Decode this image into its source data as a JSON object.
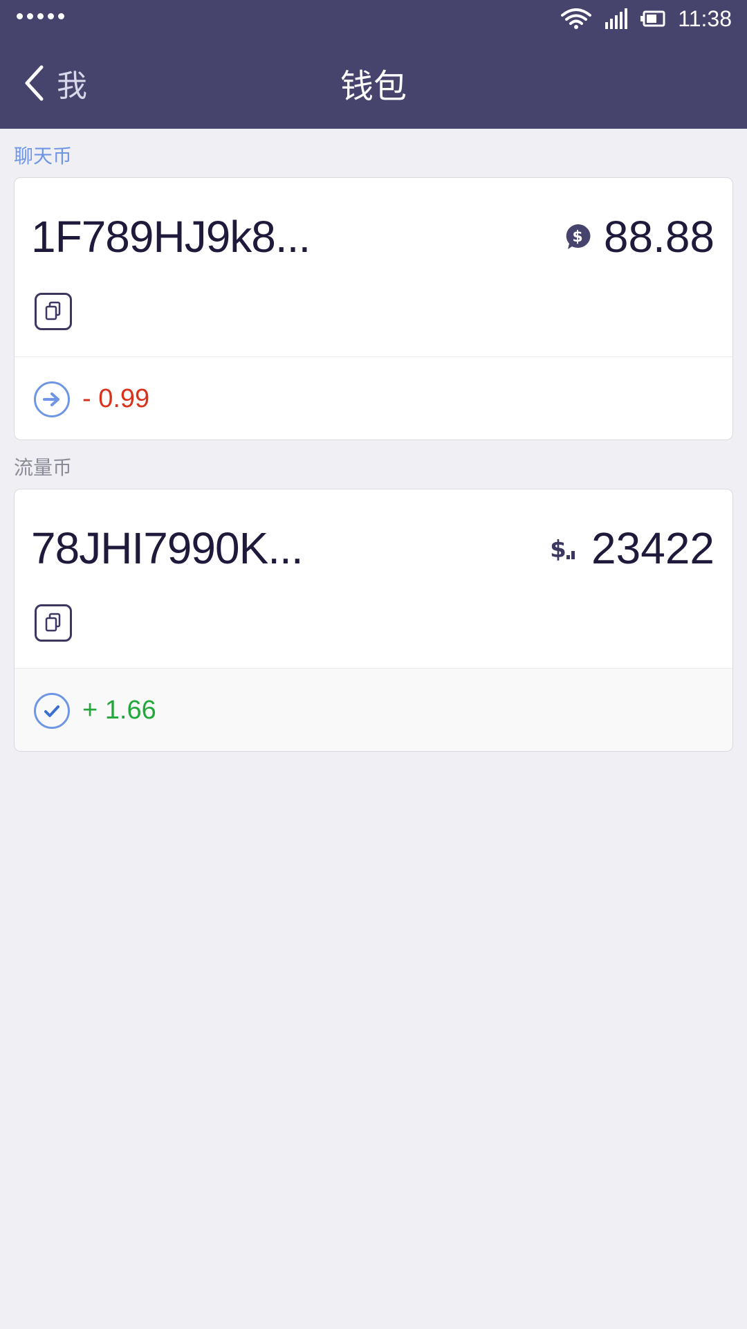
{
  "status_bar": {
    "time": "11:38",
    "icons": [
      "signal-dots-icon",
      "wifi-icon",
      "cellular-icon",
      "battery-icon"
    ]
  },
  "nav": {
    "back_label": "我",
    "title": "钱包"
  },
  "wallets": [
    {
      "section_label": "聊天币",
      "address": "1F789HJ9k8...",
      "balance": "88.88",
      "balance_icon": "chat-coin-icon",
      "pending_delta": "- 0.99",
      "pending_icon": "arrow-right-icon"
    },
    {
      "section_label": "流量币",
      "address": "78JHI7990K...",
      "balance": "23422",
      "balance_icon": "traffic-coin-icon",
      "pending_delta": "+ 1.66",
      "pending_icon": "check-icon"
    }
  ],
  "colors": {
    "header": "#46436d",
    "accent": "#6f95e5",
    "negative": "#d9321c",
    "positive": "#22a83a",
    "background": "#efeff4"
  }
}
